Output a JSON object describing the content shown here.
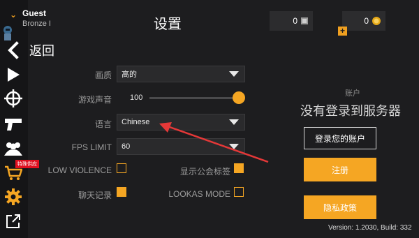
{
  "profile": {
    "name": "Guest",
    "rank": "Bronze I",
    "chevron": "⌄"
  },
  "nav": {
    "back_label": "返回",
    "special_badge": "特殊供应",
    "icons": [
      "back-chevron-icon",
      "play-icon",
      "crosshair-icon",
      "pistol-icon",
      "friends-icon",
      "cart-icon",
      "gear-icon",
      "external-link-icon"
    ]
  },
  "header": {
    "title": "设置"
  },
  "currency": [
    {
      "value": "0",
      "icon": "silver-coin-icon"
    },
    {
      "value": "0",
      "icon": "gold-coin-icon",
      "plus": "+"
    }
  ],
  "settings": {
    "quality": {
      "label": "画质",
      "value": "高的"
    },
    "volume": {
      "label": "游戏声音",
      "value": "100",
      "level_percent": 100
    },
    "language": {
      "label": "语言",
      "value": "Chinese"
    },
    "fps": {
      "label": "FPS LIMIT",
      "value": "60"
    },
    "low_violence": {
      "label": "LOW VIOLENCE",
      "checked": false
    },
    "guild_tag": {
      "label": "显示公会标签",
      "checked": true
    },
    "chat_log": {
      "label": "聊天记录",
      "checked": true
    },
    "lookas": {
      "label": "LOOKAS MODE",
      "checked": false
    }
  },
  "account": {
    "caption": "账户",
    "message": "没有登录到服务器",
    "login_button": "登录您的账户",
    "register_button": "注册",
    "privacy_button": "隐私政策"
  },
  "footer": {
    "version": "Version: 1.2030, Build: 332"
  },
  "colors": {
    "accent": "#f5a623",
    "background": "#1d1d1f",
    "annotation_arrow": "#e53838"
  }
}
